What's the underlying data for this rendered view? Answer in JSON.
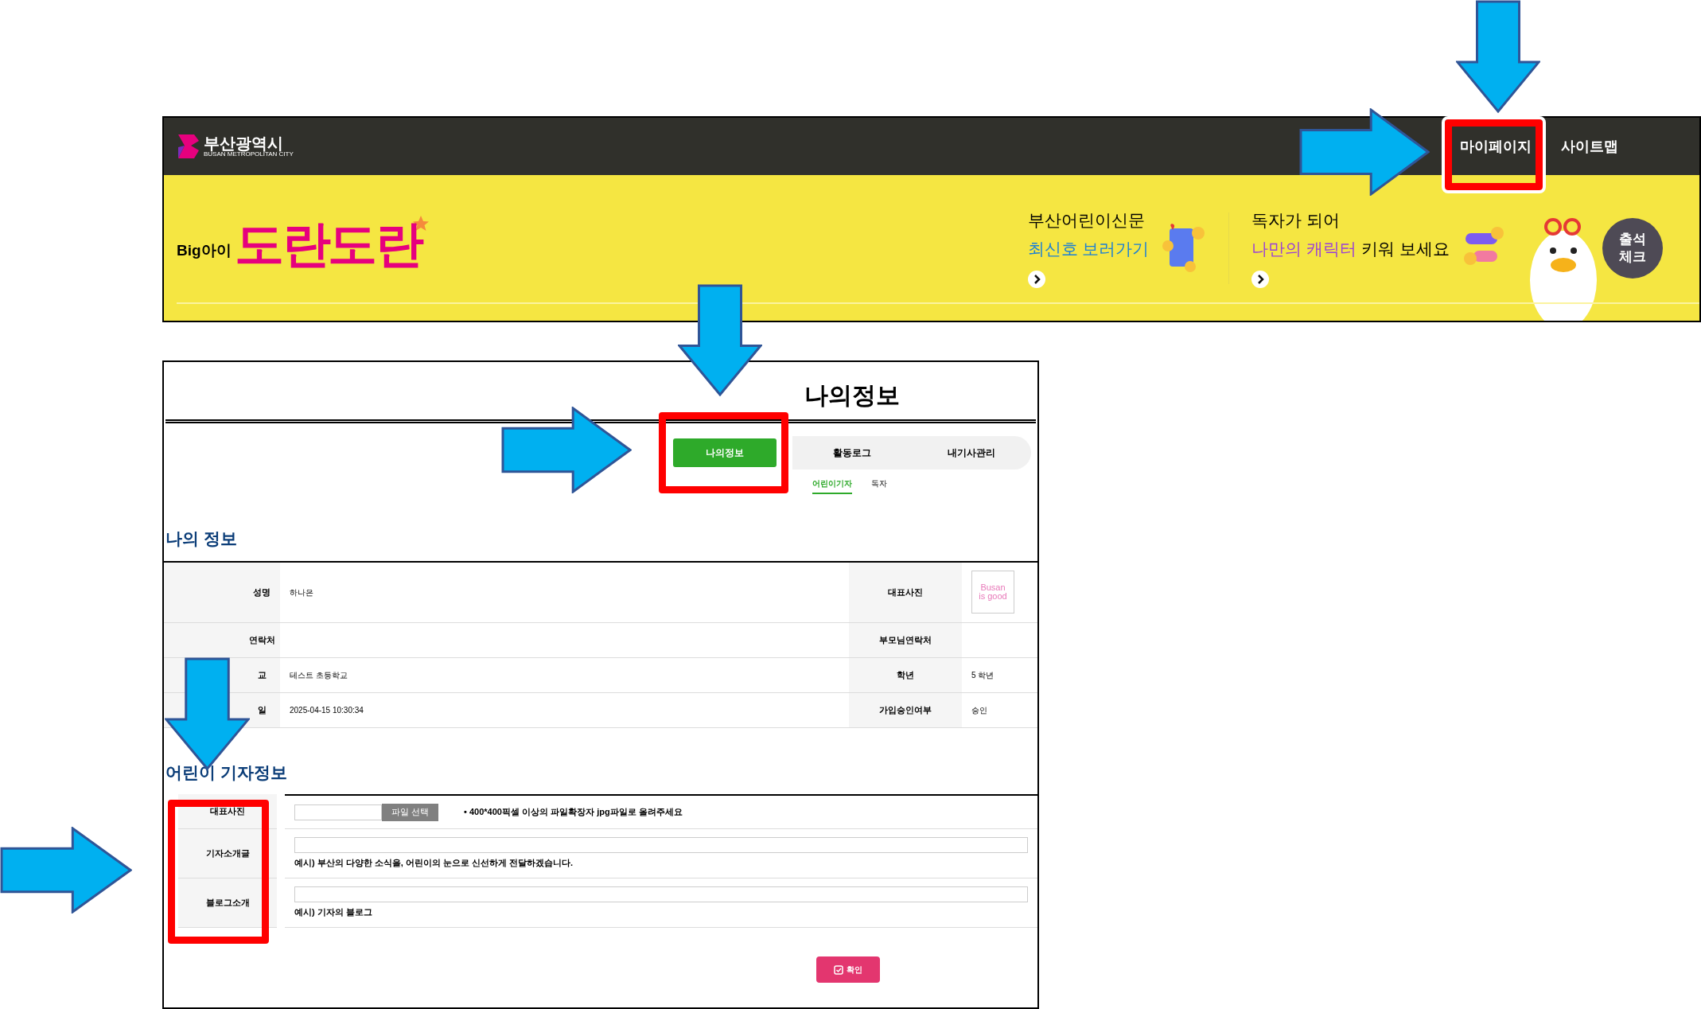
{
  "header": {
    "logo_text": "부산광역시",
    "logo_subtext": "BUSAN METROPOLITAN CITY",
    "nav": [
      {
        "label": "마이페이지"
      },
      {
        "label": "사이트맵"
      }
    ]
  },
  "banner": {
    "brand_prefix": "Big아이",
    "brand": "도란도란",
    "promos": [
      {
        "line1": "부산어린이신문",
        "highlight": "최신호 보러가기",
        "color": "#1a7fd6"
      },
      {
        "line1": "독자가 되어",
        "highlight": "나만의 캐릭터",
        "rest": "키워 보세요",
        "color": "#9a3fd8"
      }
    ],
    "badge_lines": [
      "출석",
      "체크"
    ]
  },
  "page_title": "나의정보",
  "tabs": [
    {
      "label": "나의정보",
      "selected": true
    },
    {
      "label": "활동로그",
      "selected": false
    },
    {
      "label": "내기사관리",
      "selected": false
    }
  ],
  "subtabs": [
    {
      "label": "어린이기자",
      "selected": true
    },
    {
      "label": "독자",
      "selected": false
    }
  ],
  "profile": {
    "title": "나의 정보",
    "rows": [
      {
        "label": "성명",
        "value": "하나은",
        "label2": "대표사진",
        "image_lines": [
          "Busan",
          "is good"
        ]
      },
      {
        "label": "연락처",
        "label2": "부모님연락처"
      },
      {
        "label": "교",
        "value": "테스트 초등학교",
        "label2": "학년",
        "value2": "5 학년"
      },
      {
        "label": "일",
        "value": "2025-04-15 10:30:34",
        "label2": "가입승인여부",
        "value2": "승인"
      }
    ]
  },
  "reporter": {
    "title": "어린이 기자정보",
    "rows": [
      {
        "kind": "file",
        "label": "대표사진",
        "button": "파일 선택",
        "note": "• 400*400픽셀 이상의 파일확장자 jpg파일로 올려주세요"
      },
      {
        "kind": "text",
        "label": "기자소개글",
        "hint": "예시) 부산의 다양한 소식을, 어린이의 눈으로 신선하게 전달하겠습니다."
      },
      {
        "kind": "text",
        "label": "블로그소개",
        "hint": "예시) 기자의 블로그"
      }
    ]
  },
  "submit": "확인"
}
